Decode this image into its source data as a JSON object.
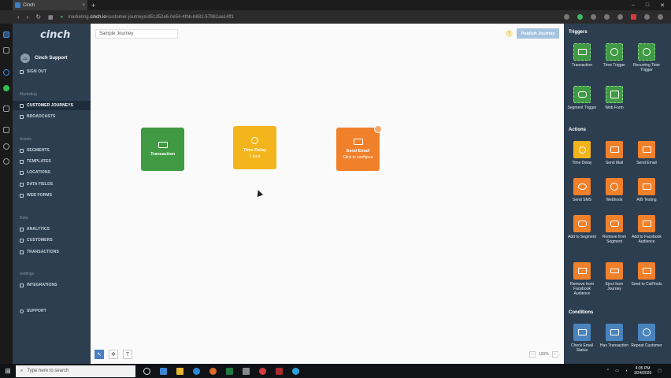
{
  "browser": {
    "tab_title": "Cinch",
    "tab_close": "×",
    "new_tab": "+",
    "url_prefix": "marketing.",
    "url_host": "cinch.io",
    "url_path": "/customer-journeys/d51352e6-0e54-4fbb-b682-57882aa14ff1",
    "back": "‹",
    "forward": "›",
    "reload": "↻",
    "minimize": "–",
    "maximize": "□",
    "close": "✕"
  },
  "app": {
    "brand": "cinch",
    "user_initials": "CS",
    "user_name": "Cinch Support",
    "sign_out": "SIGN OUT"
  },
  "sidebar": {
    "sections": [
      {
        "heading": "Marketing",
        "items": [
          {
            "label": "CUSTOMER JOURNEYS",
            "active": true
          },
          {
            "label": "BROADCASTS"
          }
        ]
      },
      {
        "heading": "Assets",
        "items": [
          {
            "label": "SEGMENTS"
          },
          {
            "label": "TEMPLATES"
          },
          {
            "label": "LOCATIONS"
          },
          {
            "label": "DATA FIELDS"
          },
          {
            "label": "WEB FORMS"
          }
        ]
      },
      {
        "heading": "Data",
        "items": [
          {
            "label": "ANALYTICS"
          },
          {
            "label": "CUSTOMERS"
          },
          {
            "label": "TRANSACTIONS"
          }
        ]
      },
      {
        "heading": "Settings",
        "items": [
          {
            "label": "INTEGRATIONS"
          }
        ]
      }
    ],
    "support": "SUPPORT"
  },
  "canvas": {
    "journey_name": "Sample Journey",
    "warning_icon_text": "!",
    "publish_label": "Publish Journey",
    "nodes": [
      {
        "title": "Transaction",
        "subtitle": ""
      },
      {
        "title": "Time Delay",
        "subtitle": "1 hour"
      },
      {
        "title": "Send Email",
        "subtitle": "Click to configure"
      }
    ],
    "tools": {
      "select": "↖",
      "move": "✥",
      "text": "T"
    },
    "zoom": {
      "minus": "–",
      "level": "100%",
      "plus": "›"
    }
  },
  "palette": {
    "triggers_heading": "Triggers",
    "triggers": [
      "Transaction",
      "Time Trigger",
      "Recurring Time Trigger",
      "Segment Trigger",
      "Web Form"
    ],
    "actions_heading": "Actions",
    "actions": [
      "Time Delay",
      "Send Mail",
      "Send Email",
      "Send SMS",
      "Webhook",
      "A/B Testing",
      "Add to Segment",
      "Remove from Segment",
      "Add to Facebook Audience",
      "Remove from Facebook Audience",
      "Eject from Journey",
      "Send to CallTools"
    ],
    "conditions_heading": "Conditions",
    "conditions": [
      "Check Email Status",
      "Has Transaction",
      "Repeat Customer"
    ]
  },
  "taskbar": {
    "search_placeholder": "Type here to search",
    "time": "4:05 PM",
    "date": "3/24/2020"
  },
  "colors": {
    "sidebar_bg": "#2c3e50",
    "trigger_green": "#3f9a43",
    "delay_yellow": "#f3b51b",
    "action_orange": "#f1802b",
    "condition_blue": "#4a84bd",
    "publish_blue": "#a6c4e0"
  }
}
